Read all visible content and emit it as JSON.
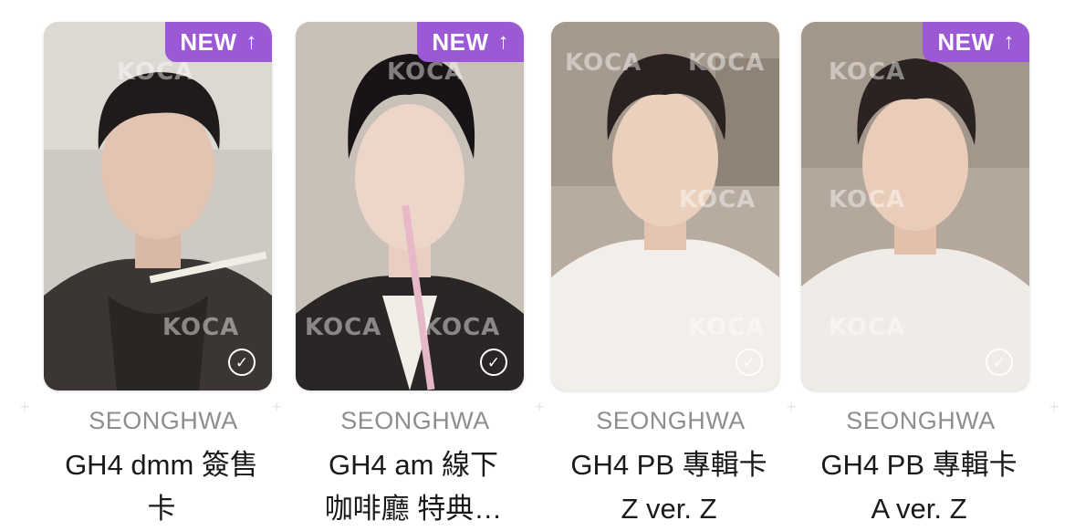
{
  "colors": {
    "badge": "#9b59d6",
    "member_text": "#8e8e8e",
    "title_text": "#1a1a1a"
  },
  "watermark_text": "KOCA",
  "cards": [
    {
      "badge_label": "NEW",
      "badge_icon": "arrow-up-icon",
      "member": "SEONGHWA",
      "title": "GH4 dmm 簽售\n卡",
      "check_icon": "check-circle-icon"
    },
    {
      "badge_label": "NEW",
      "badge_icon": "arrow-up-icon",
      "member": "SEONGHWA",
      "title": "GH4 am 線下\n咖啡廳 特典…",
      "check_icon": "check-circle-icon"
    },
    {
      "badge_label": "",
      "member": "SEONGHWA",
      "title": "GH4 PB 專輯卡\nZ ver. Z",
      "check_icon": "check-circle-icon"
    },
    {
      "badge_label": "NEW",
      "badge_icon": "arrow-up-icon",
      "member": "SEONGHWA",
      "title": "GH4 PB 專輯卡\nA ver. Z",
      "check_icon": "check-circle-icon"
    }
  ]
}
